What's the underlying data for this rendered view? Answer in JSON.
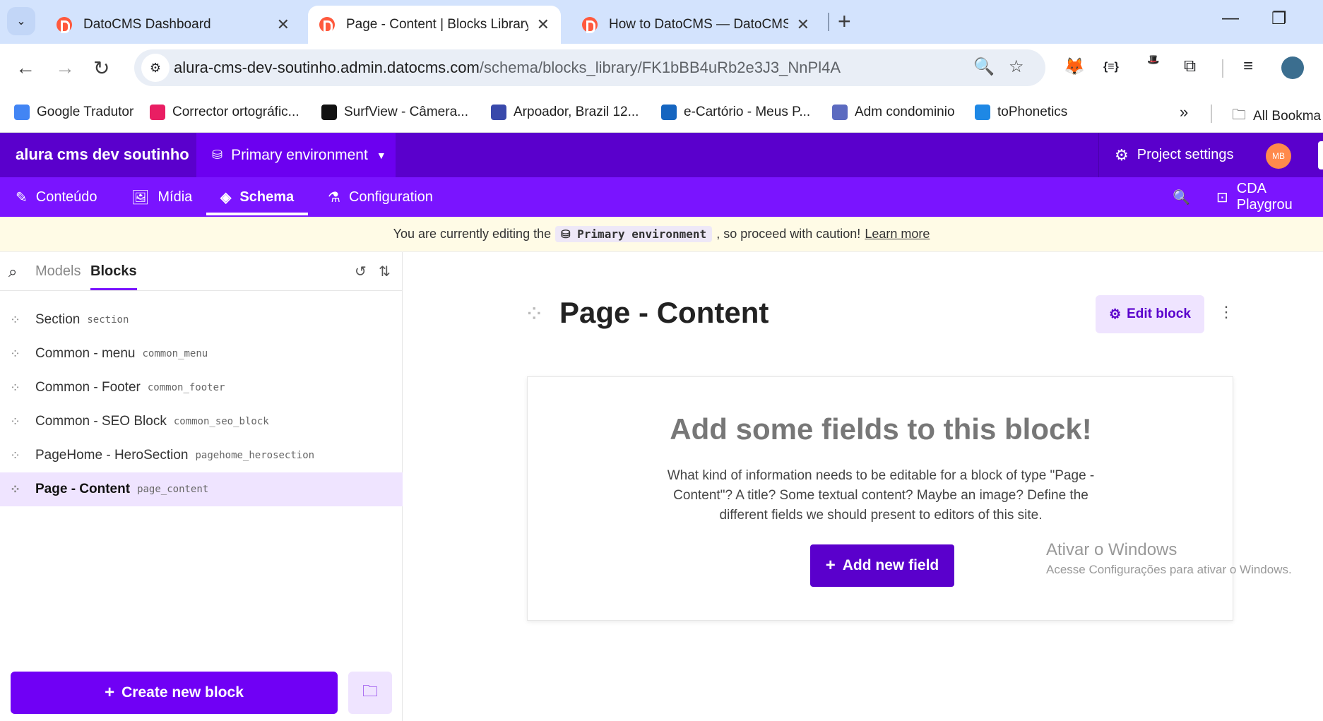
{
  "browser": {
    "tabs": [
      {
        "title": "DatoCMS Dashboard"
      },
      {
        "title": "Page - Content | Blocks Library |"
      },
      {
        "title": "How to DatoCMS — DatoCMS"
      }
    ],
    "url_host": "alura-cms-dev-soutinho.admin.datocms.com",
    "url_path": "/schema/blocks_library/FK1bBB4uRb2e3J3_NnPl4A",
    "bookmarks": [
      {
        "label": "Google Tradutor",
        "color": "#4285f4"
      },
      {
        "label": "Corrector ortográfic...",
        "color": "#e91e63"
      },
      {
        "label": "SurfView - Câmera...",
        "color": "#111111"
      },
      {
        "label": "Arpoador, Brazil 12...",
        "color": "#3949ab"
      },
      {
        "label": "e-Cartório - Meus P...",
        "color": "#1565c0"
      },
      {
        "label": "Adm condominio",
        "color": "#5c6bc0"
      },
      {
        "label": "toPhonetics",
        "color": "#1e88e5"
      }
    ],
    "all_bookmarks": "All Bookma"
  },
  "header": {
    "project": "alura cms dev soutinho",
    "environment": "Primary environment",
    "project_settings": "Project settings",
    "avatar": "MB"
  },
  "nav": {
    "items": [
      {
        "label": "Conteúdo",
        "icon": "edit-icon"
      },
      {
        "label": "Mídia",
        "icon": "image-icon"
      },
      {
        "label": "Schema",
        "icon": "layers-icon"
      },
      {
        "label": "Configuration",
        "icon": "flask-gear-icon"
      }
    ],
    "cda": "CDA Playgrou"
  },
  "banner": {
    "before": "You are currently editing the",
    "env": "Primary environment",
    "after": ", so proceed with caution!",
    "link": "Learn more"
  },
  "sidebar": {
    "tabs": [
      "Models",
      "Blocks"
    ],
    "blocks": [
      {
        "name": "Section",
        "key": "section"
      },
      {
        "name": "Common - menu",
        "key": "common_menu"
      },
      {
        "name": "Common - Footer",
        "key": "common_footer"
      },
      {
        "name": "Common - SEO Block",
        "key": "common_seo_block"
      },
      {
        "name": "PageHome - HeroSection",
        "key": "pagehome_herosection"
      },
      {
        "name": "Page - Content",
        "key": "page_content"
      }
    ],
    "create_button": "Create new block"
  },
  "main": {
    "title": "Page - Content",
    "edit_button": "Edit block",
    "empty_title": "Add some fields to this block!",
    "empty_text": "What kind of information needs to be editable for a block of type \"Page - Content\"? A title? Some textual content? Maybe an image? Define the different fields we should present to editors of this site.",
    "add_field_button": "Add new field"
  },
  "watermark": {
    "title": "Ativar o Windows",
    "subtitle": "Acesse Configurações para ativar o Windows."
  }
}
